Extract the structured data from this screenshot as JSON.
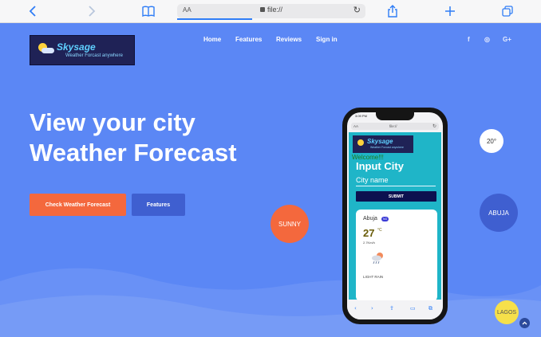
{
  "browser": {
    "text_size_label": "AA",
    "url": "file://",
    "colors": {
      "accent": "#2f7df6"
    },
    "icons": [
      "back-icon",
      "forward-icon",
      "bookmarks-icon",
      "lock-icon",
      "reload-icon",
      "share-icon",
      "new-tab-icon",
      "tabs-icon"
    ]
  },
  "site": {
    "logo": {
      "name": "Skysage",
      "tagline": "Weather Forcast anywhere"
    },
    "nav": [
      "Home",
      "Features",
      "Reviews",
      "Sign in"
    ],
    "social": [
      "f",
      "◎",
      "G+"
    ],
    "hero": {
      "line1": "View your city",
      "line2": "Weather Forecast"
    },
    "buttons": {
      "primary": "Check Weather Forecast",
      "secondary": "Features"
    },
    "bubbles": {
      "sunny": "SUNNY",
      "temp": "20°",
      "abuja": "ABUJA",
      "lagos": "LAGOS"
    },
    "colors": {
      "background": "#5b87f5",
      "primary_button": "#f4683d",
      "secondary_button": "#3f5fd0",
      "sunny_bubble": "#f4683d",
      "abuja_bubble": "#3f5fd0",
      "lagos_bubble": "#f6e04a"
    }
  },
  "phone": {
    "status_time": "3:09 PM",
    "url": "file://",
    "logo": {
      "name": "Skysage",
      "tagline": "Weather Forcast anywhere"
    },
    "welcome": "Welcome!!!",
    "heading": "Input City",
    "city_placeholder": "City name",
    "submit": "SUBMIT",
    "card": {
      "city": "Abuja",
      "badge": "NG",
      "temp": "27",
      "unit": "°C",
      "wind": "2.7Km/h",
      "description": "LIGHT RAIN"
    }
  }
}
